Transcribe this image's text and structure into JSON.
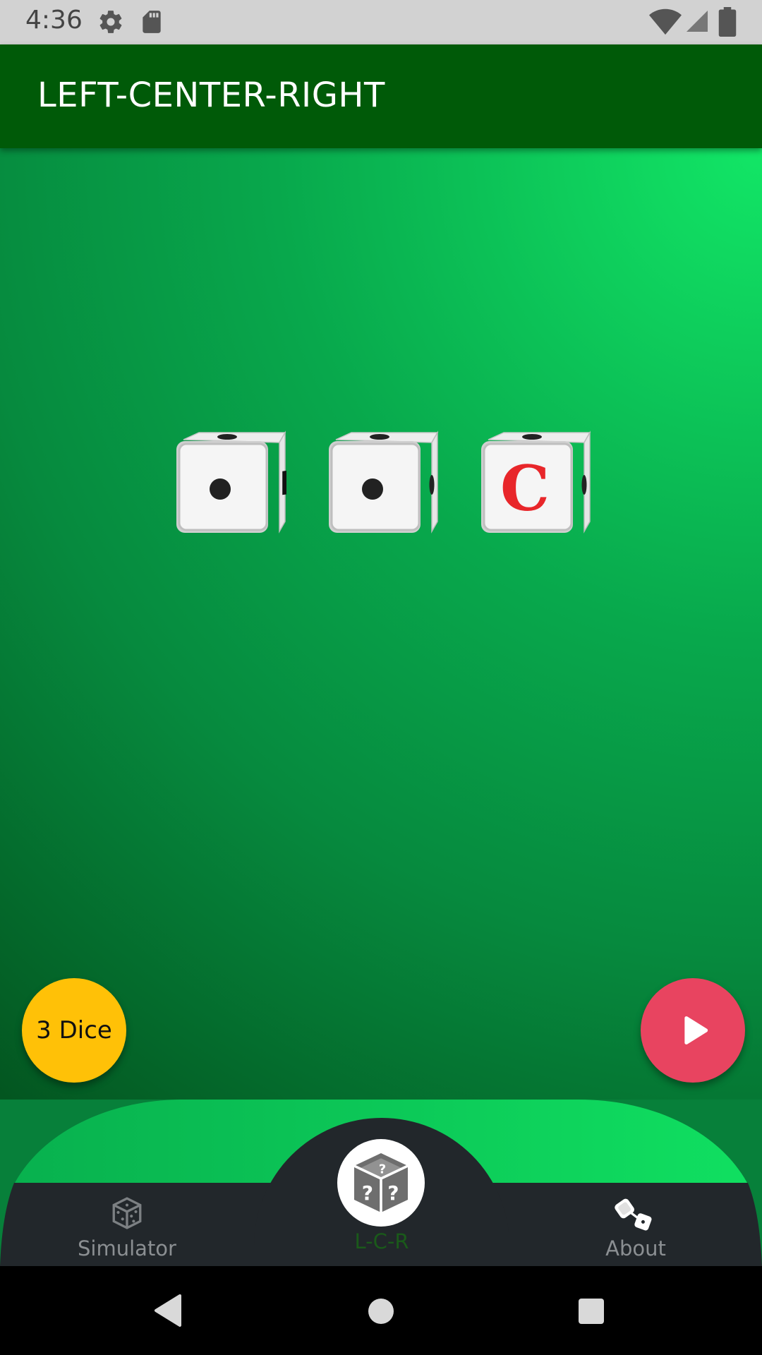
{
  "status_bar": {
    "time": "4:36",
    "left_icons": [
      "gear-icon",
      "sd-card-icon"
    ],
    "right_icons": [
      "wifi-icon",
      "cell-signal-icon",
      "battery-icon"
    ]
  },
  "app_bar": {
    "title": "LEFT-CENTER-RIGHT"
  },
  "dice": [
    {
      "face": "dot",
      "side": "R"
    },
    {
      "face": "dot",
      "side": "dot"
    },
    {
      "face": "C",
      "side": "dot"
    }
  ],
  "fab_dice": {
    "label": "3 Dice"
  },
  "fab_play": {
    "icon": "play-icon"
  },
  "bottom_nav": {
    "items": [
      {
        "label": "Simulator",
        "icon": "dice-outline-icon"
      },
      {
        "label": "L-C-R",
        "icon": "mystery-dice-icon",
        "selected": true
      },
      {
        "label": "About",
        "icon": "dice-pair-icon"
      }
    ]
  },
  "system_nav": [
    "back-icon",
    "home-icon",
    "recents-icon"
  ],
  "colors": {
    "app_bar": "#005a08",
    "fab_dice": "#ffc107",
    "fab_play": "#e84460",
    "nav_dark": "#22272b",
    "die_c_letter": "#e8262a"
  }
}
